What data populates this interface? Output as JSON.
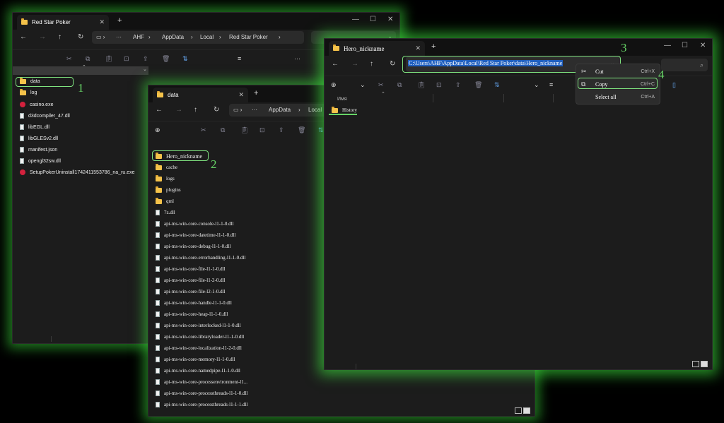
{
  "window1": {
    "tab_title": "Red Star Poker",
    "breadcrumb": [
      "AHF",
      "AppData",
      "Local",
      "Red Star Poker"
    ],
    "files": [
      {
        "name": "data",
        "type": "folder"
      },
      {
        "name": "log",
        "type": "folder"
      },
      {
        "name": "casino.exe",
        "type": "exe"
      },
      {
        "name": "d3dcompiler_47.dll",
        "type": "file"
      },
      {
        "name": "libEGL.dll",
        "type": "file"
      },
      {
        "name": "libGLESv2.dll",
        "type": "file"
      },
      {
        "name": "manifest.json",
        "type": "file"
      },
      {
        "name": "opengl32sw.dll",
        "type": "file"
      },
      {
        "name": "SetupPokerUninstall1742411553786_na_ru.exe",
        "type": "exe"
      }
    ]
  },
  "window2": {
    "tab_title": "data",
    "breadcrumb": [
      "AppData",
      "Local"
    ],
    "files": [
      {
        "name": "Hero_nickname",
        "type": "folder"
      },
      {
        "name": "cache",
        "type": "folder"
      },
      {
        "name": "logs",
        "type": "folder"
      },
      {
        "name": "plugins",
        "type": "folder"
      },
      {
        "name": "qml",
        "type": "folder"
      },
      {
        "name": "7z.dll",
        "type": "file"
      },
      {
        "name": "api-ms-win-core-console-l1-1-0.dll",
        "type": "file"
      },
      {
        "name": "api-ms-win-core-datetime-l1-1-0.dll",
        "type": "file"
      },
      {
        "name": "api-ms-win-core-debug-l1-1-0.dll",
        "type": "file"
      },
      {
        "name": "api-ms-win-core-errorhandling-l1-1-0.dll",
        "type": "file"
      },
      {
        "name": "api-ms-win-core-file-l1-1-0.dll",
        "type": "file"
      },
      {
        "name": "api-ms-win-core-file-l1-2-0.dll",
        "type": "file"
      },
      {
        "name": "api-ms-win-core-file-l2-1-0.dll",
        "type": "file"
      },
      {
        "name": "api-ms-win-core-handle-l1-1-0.dll",
        "type": "file"
      },
      {
        "name": "api-ms-win-core-heap-l1-1-0.dll",
        "type": "file"
      },
      {
        "name": "api-ms-win-core-interlocked-l1-1-0.dll",
        "type": "file"
      },
      {
        "name": "api-ms-win-core-libraryloader-l1-1-0.dll",
        "type": "file"
      },
      {
        "name": "api-ms-win-core-localization-l1-2-0.dll",
        "type": "file"
      },
      {
        "name": "api-ms-win-core-memory-l1-1-0.dll",
        "type": "file"
      },
      {
        "name": "api-ms-win-core-namedpipe-l1-1-0.dll",
        "type": "file"
      },
      {
        "name": "api-ms-win-core-processenvironment-l1...",
        "type": "file"
      },
      {
        "name": "api-ms-win-core-processthreads-l1-1-0.dll",
        "type": "file"
      },
      {
        "name": "api-ms-win-core-processthreads-l1-1-1.dll",
        "type": "file"
      }
    ]
  },
  "window3": {
    "tab_title": "Hero_nickname",
    "address": "C:\\Users\\AHF\\AppData\\Local\\Red Star Poker\\data\\Hero_nickname",
    "column_name": "Имя",
    "files": [
      {
        "name": "History",
        "type": "folder"
      }
    ]
  },
  "context_menu": {
    "items": [
      {
        "label": "Cut",
        "shortcut": "Ctrl+X",
        "icon": "scissors-icon"
      },
      {
        "label": "Copy",
        "shortcut": "Ctrl+C",
        "icon": "copy-icon"
      },
      {
        "label": "Select all",
        "shortcut": "Ctrl+A",
        "icon": ""
      }
    ]
  },
  "step_labels": [
    "1",
    "2",
    "3",
    "4"
  ],
  "accent_color": "#67d567",
  "selection_color": "#1f5fbf"
}
